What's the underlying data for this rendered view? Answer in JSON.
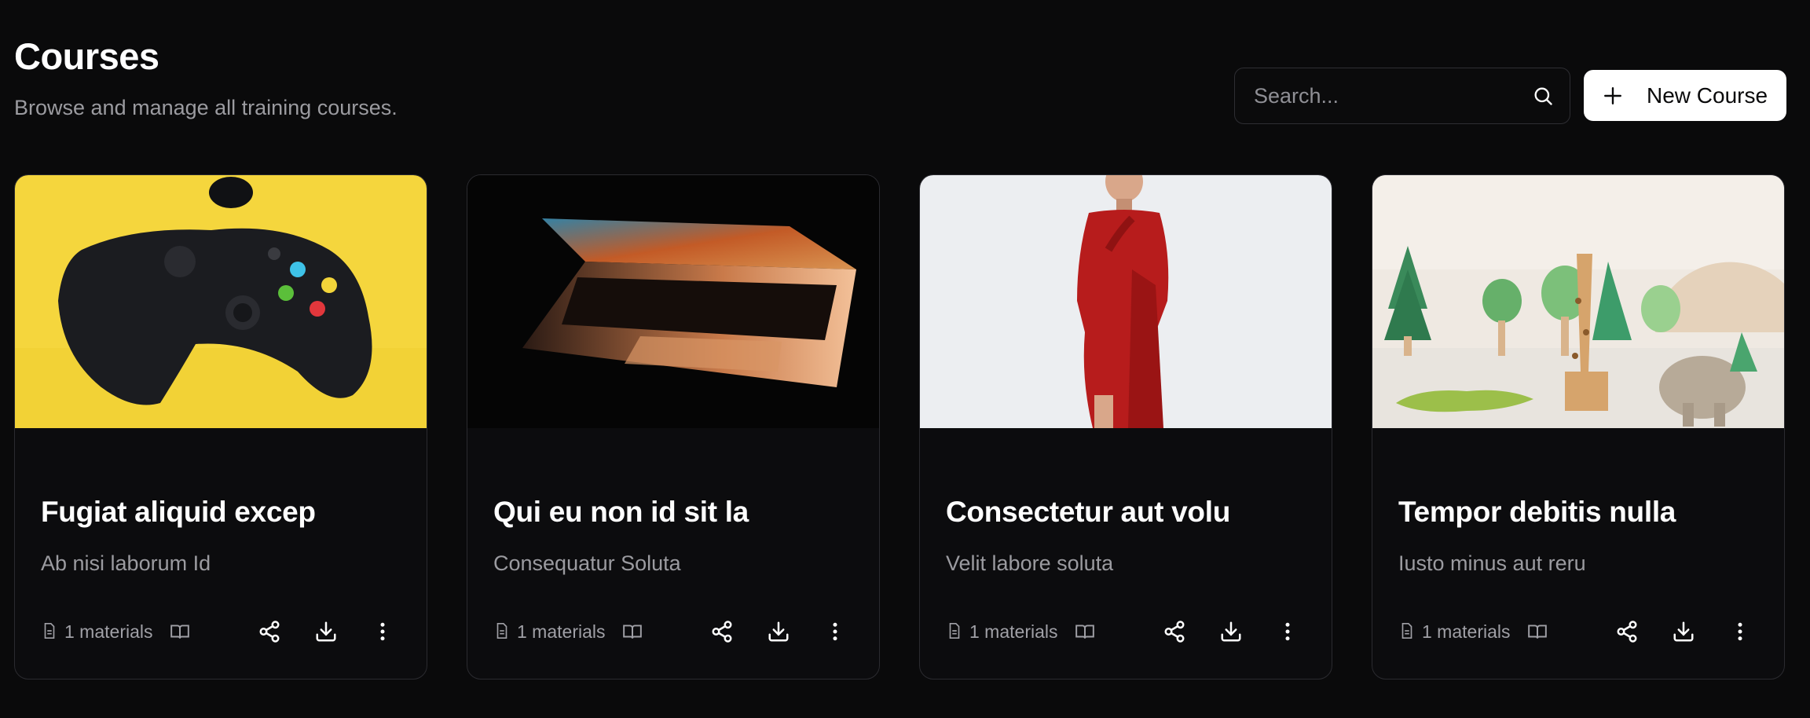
{
  "header": {
    "title": "Courses",
    "subtitle": "Browse and manage all training courses.",
    "search_placeholder": "Search...",
    "new_button_label": "New Course"
  },
  "icons": {
    "search": "search-icon",
    "new": "plus-icon",
    "materials": "file-text-icon",
    "book": "book-open-icon",
    "share": "share-icon",
    "download": "download-icon",
    "more": "more-vertical-icon"
  },
  "colors": {
    "background": "#0a0a0b",
    "card_border": "#2b2b30",
    "primary_button": "#ffffff",
    "muted_text": "#9b9ba0"
  },
  "courses": [
    {
      "title": "Fugiat aliquid excep",
      "description": "Ab nisi laborum Id",
      "materials": "1 materials",
      "image": "game-controller-image"
    },
    {
      "title": "Qui eu non id sit la",
      "description": "Consequatur Soluta",
      "materials": "1 materials",
      "image": "laptop-image"
    },
    {
      "title": "Consectetur aut volu",
      "description": "Velit labore soluta",
      "materials": "1 materials",
      "image": "red-dress-model-image"
    },
    {
      "title": "Tempor debitis nulla",
      "description": "Iusto minus aut reru",
      "materials": "1 materials",
      "image": "wooden-toys-image"
    }
  ]
}
